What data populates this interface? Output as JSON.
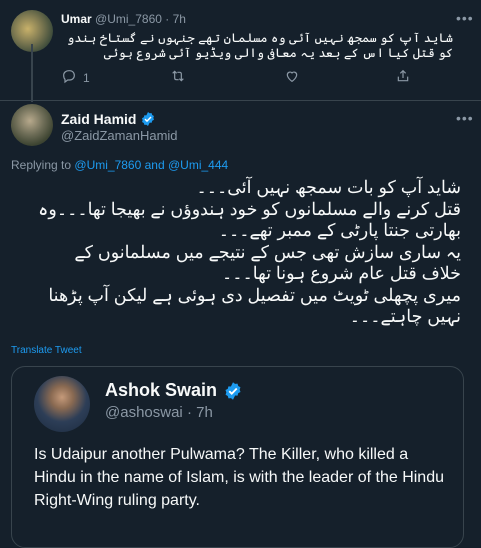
{
  "colors": {
    "background": "#15202b",
    "text": "#f7f9f9",
    "muted": "#8b98a5",
    "link": "#1d9bf0",
    "border": "#38444d"
  },
  "reply_tweet": {
    "name": "Umar",
    "handle": "@Umi_7860",
    "separator": "·",
    "time": "7h",
    "text": "شاید آپ کو سمجھ نہیں آئی وہ مسلمان تھے جنہوں نے گستاخ ہندو کو قتل کیا اس کے بعد یہ معافی والی ویڈیو آئی شروع ہوئی",
    "reply_count": "1",
    "icons": [
      "more-icon",
      "reply-icon",
      "retweet-icon",
      "like-icon",
      "share-icon"
    ]
  },
  "main_tweet": {
    "name": "Zaid Hamid",
    "handle": "@ZaidZamanHamid",
    "replying_prefix": "Replying to",
    "replying_user1": "@Umi_7860",
    "replying_and": "and",
    "replying_user2": "@Umi_444",
    "text_lines": [
      "شاید آپ کو بات سمجھ نہیں آئی۔۔۔",
      "قتل کرنے والے مسلمانوں کو خود ہندوؤں نے بھیجا تھا۔۔۔وہ",
      "بھارتی جنتا پارٹی کے ممبر تھے۔۔۔",
      "یہ ساری سازش تھی جس کے نتیجے میں مسلمانوں کے",
      "خلاف قتل عام شروع ہونا تھا۔۔۔",
      "میری پچھلی ٹویٹ میں تفصیل دی ہوئی ہے لیکن آپ پڑھنا",
      "نہیں چاہتے۔۔۔"
    ],
    "translate_label": "Translate Tweet"
  },
  "quoted_tweet": {
    "name": "Ashok Swain",
    "handle": "@ashoswai",
    "separator": "·",
    "time": "7h",
    "text": "Is Udaipur another Pulwama? The Killer, who killed a Hindu in the name of Islam, is with the leader of the Hindu Right-Wing ruling party."
  }
}
